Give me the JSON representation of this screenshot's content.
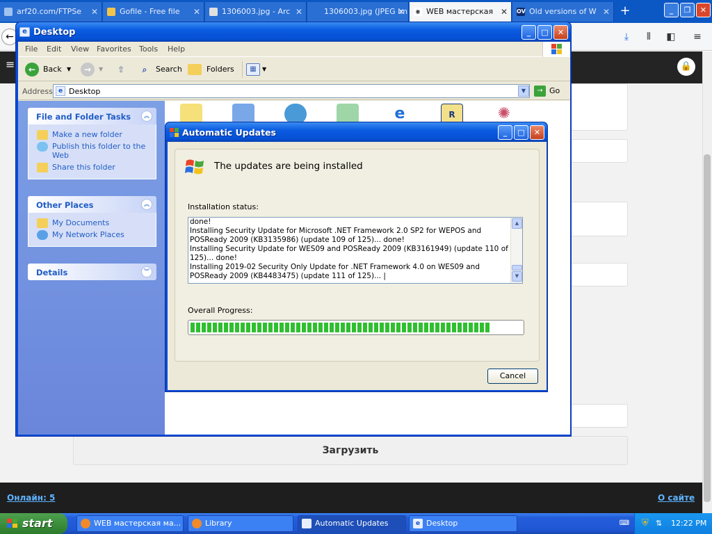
{
  "browser": {
    "tabs": [
      {
        "label": "arf20.com/FTPSe",
        "icon": "page-icon"
      },
      {
        "label": "Gofile - Free file",
        "icon": "gofile-icon"
      },
      {
        "label": "1306003.jpg - Arc",
        "icon": "image-icon"
      },
      {
        "label": "1306003.jpg (JPEG Im",
        "icon": "page-icon"
      },
      {
        "label": "WEB мастерская",
        "icon": "eye-icon"
      },
      {
        "label": "Old versions of W",
        "icon": "ov-icon",
        "badge": "OV"
      }
    ],
    "active_tab_index": 4
  },
  "site": {
    "upload_button": "Загрузить",
    "online_link": "Онлайн: 5",
    "about_link": "О сайте"
  },
  "explorer": {
    "title": "Desktop",
    "menu": [
      "File",
      "Edit",
      "View",
      "Favorites",
      "Tools",
      "Help"
    ],
    "toolbar": {
      "back": "Back",
      "search": "Search",
      "folders": "Folders"
    },
    "address_label": "Address",
    "address_value": "Desktop",
    "go_label": "Go",
    "panes": {
      "file_tasks": {
        "title": "File and Folder Tasks",
        "links": [
          "Make a new folder",
          "Publish this folder to the Web",
          "Share this folder"
        ]
      },
      "other_places": {
        "title": "Other Places",
        "links": [
          "My Documents",
          "My Network Places"
        ]
      },
      "details": {
        "title": "Details"
      }
    }
  },
  "updates_dialog": {
    "title": "Automatic Updates",
    "heading": "The updates are being installed",
    "status_label": "Installation status:",
    "log_lines": [
      "done!",
      "Installing Security Update for Microsoft .NET Framework 2.0 SP2 for WEPOS and POSReady 2009 (KB3135986) (update 109 of 125)... done!",
      "Installing Security Update for WES09 and POSReady 2009 (KB3161949) (update 110 of 125)... done!",
      "Installing 2019-02 Security Only Update for .NET Framework 4.0 on WES09 and POSReady 2009 (KB4483475) (update 111 of 125)... |"
    ],
    "progress_label": "Overall Progress:",
    "progress_fraction": 0.9,
    "cancel_label": "Cancel"
  },
  "taskbar": {
    "start_label": "start",
    "tasks": [
      {
        "label": "WEB мастерская ма...",
        "icon": "firefox-icon"
      },
      {
        "label": "Library",
        "icon": "library-icon"
      },
      {
        "label": "Automatic Updates",
        "icon": "windows-update-icon",
        "active": true
      },
      {
        "label": "Desktop",
        "icon": "desktop-icon"
      }
    ],
    "clock": "12:22 PM"
  },
  "colors": {
    "xp_blue": "#0a4ad6",
    "progress_green": "#2fbf2f",
    "task_link": "#215dc6"
  }
}
